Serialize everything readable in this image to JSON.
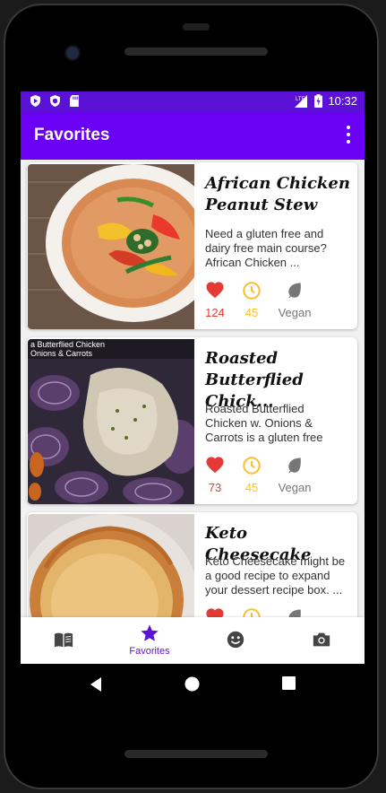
{
  "status_bar": {
    "time": "10:32",
    "network": "LTE"
  },
  "app_bar": {
    "title": "Favorites"
  },
  "colors": {
    "primary": "#6a00f4",
    "status_bar": "#5b12d6",
    "like": "#e53935",
    "time": "#fbc02d",
    "vegan": "#777777",
    "active_tab": "#5e12d6"
  },
  "recipes": [
    {
      "title": "African Chicken Peanut Stew",
      "description": "Need a gluten free and dairy free main course? African Chicken ...",
      "likes": "124",
      "minutes": "45",
      "diet": "Vegan"
    },
    {
      "title": "Roasted Butterflied Chick...",
      "description": "Roasted Butterflied Chicken w. Onions & Carrots is a gluten free an...",
      "likes": "73",
      "minutes": "45",
      "diet": "Vegan",
      "image_caption": "a Butterflied Chicken\nOnions & Carrots"
    },
    {
      "title": "Keto Cheesecake",
      "description": "Keto Cheesecake might be a good recipe to expand your dessert recipe box. ..."
    }
  ],
  "bottom_nav": {
    "tabs": [
      {
        "icon": "menu-book-icon"
      },
      {
        "icon": "star-icon",
        "label": "Favorites",
        "active": true
      },
      {
        "icon": "smiley-icon"
      },
      {
        "icon": "camera-icon"
      }
    ]
  }
}
